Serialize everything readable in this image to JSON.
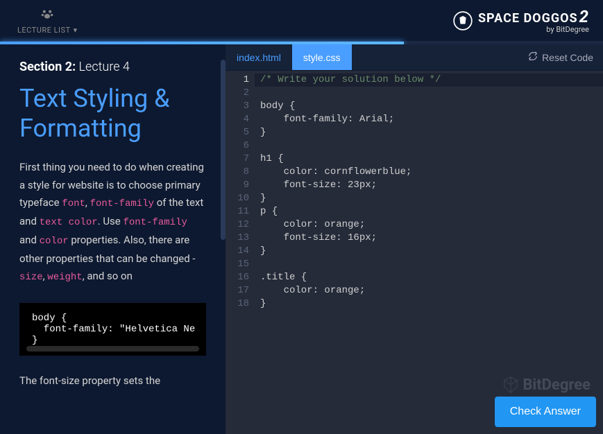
{
  "header": {
    "lecture_list_label": "LECTURE LIST",
    "brand_title": "SPACE DOGGOS",
    "brand_version": "2",
    "brand_sub": "by BitDegree"
  },
  "sidebar": {
    "section_bold": "Section 2:",
    "section_light": " Lecture 4",
    "lesson_title": "Text Styling & Formatting",
    "para1_parts": [
      {
        "t": "First thing you need to do when creating a style for website is to choose primary typeface "
      },
      {
        "t": "font",
        "kw": true
      },
      {
        "t": ", "
      },
      {
        "t": "font-family",
        "kw": true
      },
      {
        "t": " of the text and "
      },
      {
        "t": "text color",
        "kw": true
      },
      {
        "t": ". Use "
      },
      {
        "t": "font-family",
        "kw": true
      },
      {
        "t": " and "
      },
      {
        "t": "color",
        "kw": true
      },
      {
        "t": " properties. Also, there are other properties that can be changed - "
      },
      {
        "t": "size",
        "kw": true
      },
      {
        "t": ", "
      },
      {
        "t": "weight",
        "kw": true
      },
      {
        "t": ", and so on"
      }
    ],
    "code_sample": "body {\n  font-family: \"Helvetica Ne\n}",
    "para2_prefix": "The ",
    "para2_kw": "font-size",
    "para2_suffix": " property sets the"
  },
  "editor": {
    "tabs": [
      {
        "label": "index.html",
        "active": false
      },
      {
        "label": "style.css",
        "active": true
      }
    ],
    "reset_label": "Reset Code",
    "active_line": 1,
    "lines": [
      "/* Write your solution below */",
      "",
      "body {",
      "    font-family: Arial;",
      "}",
      "",
      "h1 {",
      "    color: cornflowerblue;",
      "    font-size: 23px;",
      "}",
      "p {",
      "    color: orange;",
      "    font-size: 16px;",
      "}",
      "",
      ".title {",
      "    color: orange;",
      "}"
    ],
    "watermark": "BitDegree",
    "check_label": "Check Answer"
  }
}
